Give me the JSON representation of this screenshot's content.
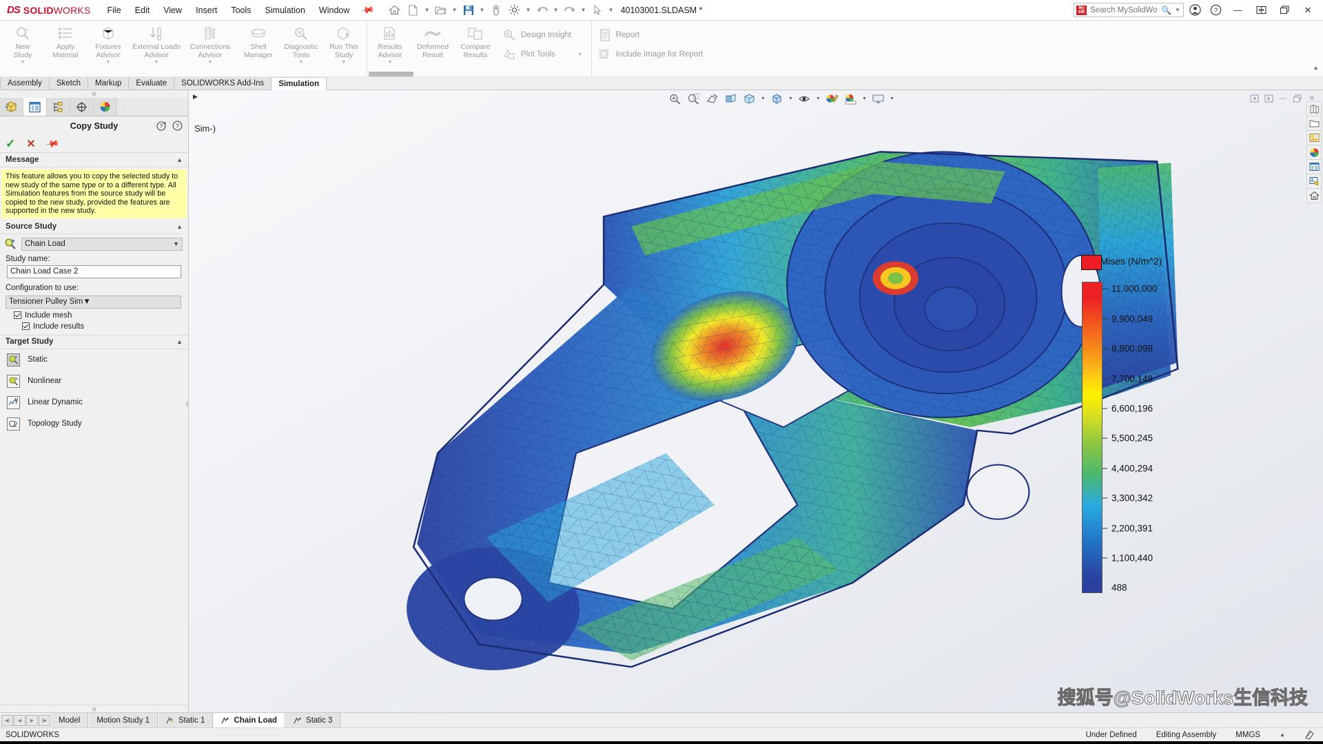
{
  "app": {
    "brand_ds": "DS",
    "brand_name_bold": "SOLID",
    "brand_name_light": "WORKS",
    "document_title": "40103001.SLDASM *",
    "status_name": "SOLIDWORKS"
  },
  "menu": {
    "items": [
      {
        "label": "File"
      },
      {
        "label": "Edit"
      },
      {
        "label": "View"
      },
      {
        "label": "Insert"
      },
      {
        "label": "Tools"
      },
      {
        "label": "Simulation"
      },
      {
        "label": "Window"
      }
    ],
    "pin_icon": "pin-icon"
  },
  "quick_access": {
    "buttons": [
      {
        "name": "home-icon"
      },
      {
        "name": "new-document-icon"
      },
      {
        "name": "open-folder-icon"
      },
      {
        "name": "save-icon"
      },
      {
        "name": "print-icon"
      },
      {
        "name": "options-gear-icon"
      },
      {
        "name": "undo-icon"
      },
      {
        "name": "redo-icon"
      },
      {
        "name": "select-pointer-icon"
      }
    ]
  },
  "search": {
    "placeholder": "Search MySolidWorks",
    "value": "",
    "badge": "MySW",
    "magnifier_icon": "search-icon"
  },
  "title_right": {
    "account_icon": "user-account-icon",
    "help_icon": "help-question-icon",
    "minimize": "—",
    "restore": "restore-icon",
    "close": "✕"
  },
  "ribbon": {
    "groups": [
      {
        "name": "study-setup",
        "buttons": [
          {
            "label_line1": "New",
            "label_line2": "Study",
            "icon": "new-study-icon",
            "has_dropdown": true
          },
          {
            "label_line1": "Apply",
            "label_line2": "Material",
            "icon": "apply-material-icon",
            "has_dropdown": false
          },
          {
            "label_line1": "Fixtures",
            "label_line2": "Advisor",
            "icon": "fixtures-advisor-icon",
            "has_dropdown": true
          },
          {
            "label_line1": "External Loads",
            "label_line2": "Advisor",
            "icon": "external-loads-icon",
            "has_dropdown": true
          },
          {
            "label_line1": "Connections",
            "label_line2": "Advisor",
            "icon": "connections-advisor-icon",
            "has_dropdown": true
          },
          {
            "label_line1": "Shell",
            "label_line2": "Manager",
            "icon": "shell-manager-icon",
            "has_dropdown": false
          },
          {
            "label_line1": "Diagnostic",
            "label_line2": "Tools",
            "icon": "diagnostic-tools-icon",
            "has_dropdown": true
          },
          {
            "label_line1": "Run This",
            "label_line2": "Study",
            "icon": "run-study-icon",
            "has_dropdown": true
          }
        ]
      },
      {
        "name": "results",
        "buttons": [
          {
            "label_line1": "Results",
            "label_line2": "Advisor",
            "icon": "results-advisor-icon",
            "has_dropdown": true
          },
          {
            "label_line1": "Deformed",
            "label_line2": "Result",
            "icon": "deformed-result-icon",
            "has_dropdown": false
          },
          {
            "label_line1": "Compare",
            "label_line2": "Results",
            "icon": "compare-results-icon",
            "has_dropdown": false
          }
        ],
        "list_items": [
          {
            "label": "Design Insight",
            "icon": "design-insight-icon",
            "has_dropdown": false
          },
          {
            "label": "Plot Tools",
            "icon": "plot-tools-icon",
            "has_dropdown": true
          }
        ]
      },
      {
        "name": "report",
        "list_items": [
          {
            "label": "Report",
            "icon": "report-icon",
            "has_dropdown": false
          },
          {
            "label": "Include Image for Report",
            "icon": "include-image-icon",
            "has_dropdown": false
          }
        ]
      }
    ]
  },
  "command_tabs": {
    "items": [
      {
        "label": "Assembly",
        "active": false
      },
      {
        "label": "Sketch",
        "active": false
      },
      {
        "label": "Markup",
        "active": false
      },
      {
        "label": "Evaluate",
        "active": false
      },
      {
        "label": "SOLIDWORKS Add-Ins",
        "active": false
      },
      {
        "label": "Simulation",
        "active": true
      }
    ]
  },
  "property_manager": {
    "tabs": [
      {
        "name": "feature-manager-tree-tab",
        "active": false
      },
      {
        "name": "property-manager-tab",
        "active": true
      },
      {
        "name": "configuration-manager-tab",
        "active": false
      },
      {
        "name": "dimxpert-manager-tab",
        "active": false
      },
      {
        "name": "display-manager-tab",
        "active": false
      }
    ],
    "title": "Copy Study",
    "help_icons": [
      "whats-new-help-icon",
      "help-icon"
    ],
    "actions": {
      "ok": "✓",
      "cancel": "✕",
      "pin": "pin-icon"
    },
    "message": {
      "header": "Message",
      "text": "This feature allows you to copy the selected study to new study of the same type or to a different type. All Simulation features from the source study will be copied to the new study, provided the features are supported in the new study."
    },
    "source_study": {
      "header": "Source Study",
      "selected_study": "Chain Load",
      "study_name_label": "Study name:",
      "study_name_value": "Chain Load Case 2",
      "configuration_label": "Configuration to use:",
      "configuration_value": "Tensioner Pulley Sim",
      "include_mesh": {
        "label": "Include mesh",
        "checked": true
      },
      "include_results": {
        "label": "Include results",
        "checked": true
      }
    },
    "target_study": {
      "header": "Target Study",
      "options": [
        {
          "label": "Static",
          "selected": true,
          "icon": "static-study-icon"
        },
        {
          "label": "Nonlinear",
          "selected": false,
          "icon": "nonlinear-study-icon"
        },
        {
          "label": "Linear Dynamic",
          "selected": false,
          "icon": "linear-dynamic-study-icon"
        },
        {
          "label": "Topology Study",
          "selected": false,
          "icon": "topology-study-icon"
        }
      ]
    }
  },
  "graphics": {
    "model_name_fragment": "Sim-)",
    "heads_up_toolbar": [
      {
        "name": "zoom-to-fit-icon",
        "dropdown": false
      },
      {
        "name": "zoom-to-area-icon",
        "dropdown": false
      },
      {
        "name": "previous-view-icon",
        "dropdown": false
      },
      {
        "name": "section-view-icon",
        "dropdown": false
      },
      {
        "name": "view-orientation-icon",
        "dropdown": true
      },
      {
        "name": "display-style-icon",
        "dropdown": true
      },
      {
        "name": "hide-show-items-icon",
        "dropdown": true
      },
      {
        "name": "edit-appearance-icon",
        "dropdown": false
      },
      {
        "name": "apply-scene-icon",
        "dropdown": true
      },
      {
        "name": "view-settings-icon",
        "dropdown": true
      }
    ],
    "window_controls": [
      {
        "name": "previous-document-icon"
      },
      {
        "name": "next-document-icon"
      },
      {
        "name": "minimize-document-icon"
      },
      {
        "name": "restore-document-icon"
      },
      {
        "name": "close-document-icon"
      }
    ],
    "vertical_toolbar": [
      {
        "name": "appearances-library-icon"
      },
      {
        "name": "file-explorer-icon"
      },
      {
        "name": "view-palette-icon"
      },
      {
        "name": "appearances-sphere-icon"
      },
      {
        "name": "custom-properties-icon"
      },
      {
        "name": "drawing-palette-icon"
      },
      {
        "name": "home-library-icon"
      }
    ],
    "watermark": "搜狐号@SolidWorks生信科技"
  },
  "chart_data": {
    "type": "heatmap",
    "title": "von Mises (N/m^2)",
    "units": "N/m^2",
    "quantity": "von Mises",
    "colorbar_labels": [
      "11,000,000",
      "9,900,049",
      "8,800,098",
      "7,700,148",
      "6,600,196",
      "5,500,245",
      "4,400,294",
      "3,300,342",
      "2,200,391",
      "1,100,440",
      "488"
    ],
    "colorbar_values": [
      11000000,
      9900049,
      8800098,
      7700148,
      6600196,
      5500245,
      4400294,
      3300342,
      2200391,
      1100440,
      488
    ],
    "min": 488,
    "max": 11000000,
    "colors": [
      "#ed2024",
      "#f7871b",
      "#fff200",
      "#8cc63f",
      "#29abe2",
      "#2a3f9e"
    ],
    "legend_position": "right"
  },
  "document_tabs": {
    "nav_buttons": [
      "first-tab-icon",
      "previous-tab-icon",
      "next-tab-icon",
      "last-tab-icon"
    ],
    "items": [
      {
        "label": "Model",
        "active": false,
        "icon": null
      },
      {
        "label": "Motion Study 1",
        "active": false,
        "icon": null
      },
      {
        "label": "Static 1",
        "active": false,
        "icon": "study-icon"
      },
      {
        "label": "Chain Load",
        "active": true,
        "icon": "study-icon"
      },
      {
        "label": "Static 3",
        "active": false,
        "icon": "study-icon"
      }
    ]
  },
  "status_bar": {
    "left": "SOLIDWORKS",
    "under_defined": "Under Defined",
    "editing": "Editing Assembly",
    "units": "MMGS",
    "units_arrow": "▲",
    "overlay_icon": "document-overlay-icon"
  }
}
